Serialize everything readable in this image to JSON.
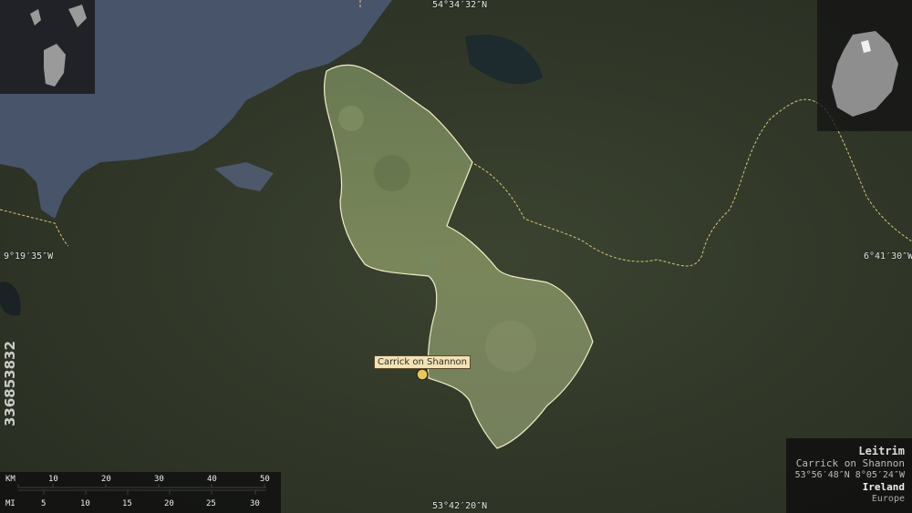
{
  "map": {
    "region_name": "Leitrim",
    "capital": "Carrick on Shannon",
    "capital_coords": "53°56′48″N 8°05′24″W",
    "country": "Ireland",
    "continent": "Europe",
    "coords": {
      "top": "54°34′32″N",
      "bottom": "53°42′20″N",
      "left": "9°19′35″W",
      "right": "6°41′30″W"
    },
    "city_marker_label": "Carrick on Shannon",
    "stock_id": "336853832",
    "colors": {
      "region_outline": "#f2eec8",
      "border_dashed": "#d8c47a",
      "label_bg": "#f3e3b4",
      "water": "#48546a"
    }
  },
  "scale_bar": {
    "km_unit": "KM",
    "mi_unit": "MI",
    "km_ticks": [
      "10",
      "20",
      "30",
      "40",
      "50"
    ],
    "mi_ticks": [
      "5",
      "10",
      "15",
      "20",
      "25",
      "30"
    ]
  }
}
